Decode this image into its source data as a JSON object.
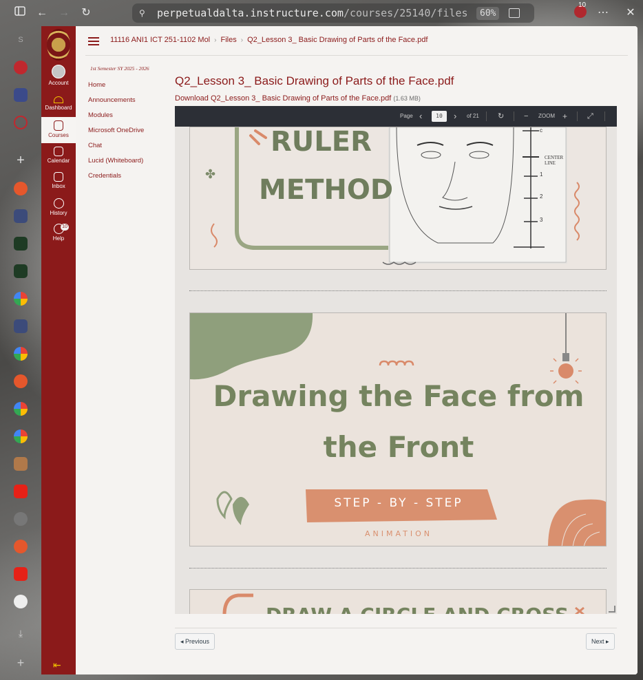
{
  "browser": {
    "url_main": "perpetualdalta.instructure.com",
    "url_path": "/courses/25140/files",
    "zoom": "60%",
    "notification_count": "10"
  },
  "global_nav": {
    "account": "Account",
    "dashboard": "Dashboard",
    "courses": "Courses",
    "calendar": "Calendar",
    "inbox": "Inbox",
    "history": "History",
    "help": "Help",
    "help_badge": "10"
  },
  "breadcrumb": {
    "course": "11116 ANI1 ICT 251-1102 Mol",
    "files": "Files",
    "file": "Q2_Lesson 3_ Basic Drawing of Parts of the Face.pdf"
  },
  "course_nav": {
    "semester": "1st Semester SY 2025 - 2026",
    "items": [
      "Home",
      "Announcements",
      "Modules",
      "Microsoft OneDrive",
      "Chat",
      "Lucid (Whiteboard)",
      "Credentials"
    ]
  },
  "file": {
    "title": "Q2_Lesson 3_ Basic Drawing of Parts of the Face.pdf",
    "download_label": "Download Q2_Lesson 3_ Basic Drawing of Parts of the Face.pdf",
    "size": "(1.63 MB)"
  },
  "pdf_toolbar": {
    "page_label": "Page",
    "page_value": "10",
    "of_label": "of 21",
    "zoom_label": "ZOOM"
  },
  "slides": {
    "slide1": {
      "line1": "RULER",
      "line2": "METHOD",
      "side_note": "CENTER LINE",
      "ticks": [
        "c",
        "1",
        "2",
        "3"
      ]
    },
    "slide2": {
      "title1": "Drawing the Face from",
      "title2": "the Front",
      "banner": "STEP - BY - STEP",
      "sub": "ANIMATION"
    },
    "slide3": {
      "title": "DRAW A CIRCLE AND CROSS"
    }
  },
  "pager": {
    "previous": "Previous",
    "next": "Next"
  },
  "colors": {
    "brand": "#8b1a1a",
    "sage": "#7d8b6a",
    "coral": "#d98a6a"
  }
}
